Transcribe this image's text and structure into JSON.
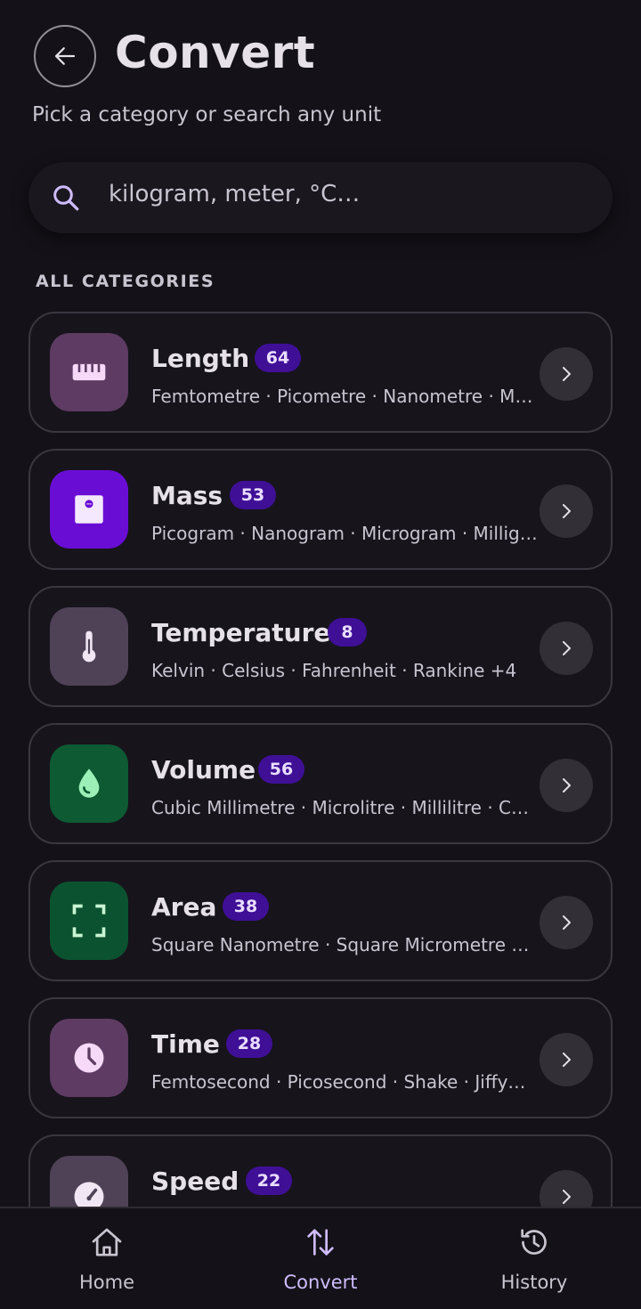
{
  "header": {
    "title": "Convert",
    "subtitle": "Pick a category or search any unit",
    "back_icon": "arrow-left-icon"
  },
  "search": {
    "placeholder": "kilogram, meter, °C…",
    "icon": "search-icon"
  },
  "section_label": "ALL CATEGORIES",
  "categories": [
    {
      "name": "Length",
      "count": "64",
      "units": "Femtometre · Picometre · Nanometre · M…",
      "icon": "ruler-icon",
      "tile_color": "#5E3B63",
      "icon_color": "#F6D8F8"
    },
    {
      "name": "Mass",
      "count": "53",
      "units": "Picogram · Nanogram · Microgram · Millig…",
      "icon": "scale-icon",
      "tile_color": "#6A0DD4",
      "icon_color": "#F3E8FF"
    },
    {
      "name": "Temperature",
      "count": "8",
      "units": "Kelvin · Celsius · Fahrenheit · Rankine  +4",
      "icon": "thermometer-icon",
      "tile_color": "#4F4256",
      "icon_color": "#F1E6F4"
    },
    {
      "name": "Volume",
      "count": "56",
      "units": "Cubic Millimetre · Microlitre · Millilitre · C…",
      "icon": "water-drop-icon",
      "tile_color": "#0D5A33",
      "icon_color": "#9CF0B7"
    },
    {
      "name": "Area",
      "count": "38",
      "units": "Square Nanometre · Square Micrometre …",
      "icon": "area-icon",
      "tile_color": "#0B5330",
      "icon_color": "#C8F5D4"
    },
    {
      "name": "Time",
      "count": "28",
      "units": "Femtosecond · Picosecond · Shake · Jiffy…",
      "icon": "clock-icon",
      "tile_color": "#5E3B63",
      "icon_color": "#F6D8F8"
    },
    {
      "name": "Speed",
      "count": "22",
      "units": "",
      "icon": "speedometer-icon",
      "tile_color": "#4F4256",
      "icon_color": "#F1E6F4"
    }
  ],
  "bottom_nav": [
    {
      "label": "Home",
      "icon": "home-icon",
      "active": false
    },
    {
      "label": "Convert",
      "icon": "swap-vertical-icon",
      "active": true
    },
    {
      "label": "History",
      "icon": "history-icon",
      "active": false
    }
  ],
  "colors": {
    "background": "#141218",
    "badge": "#3F0F96",
    "accent": "#CFBCFF"
  }
}
